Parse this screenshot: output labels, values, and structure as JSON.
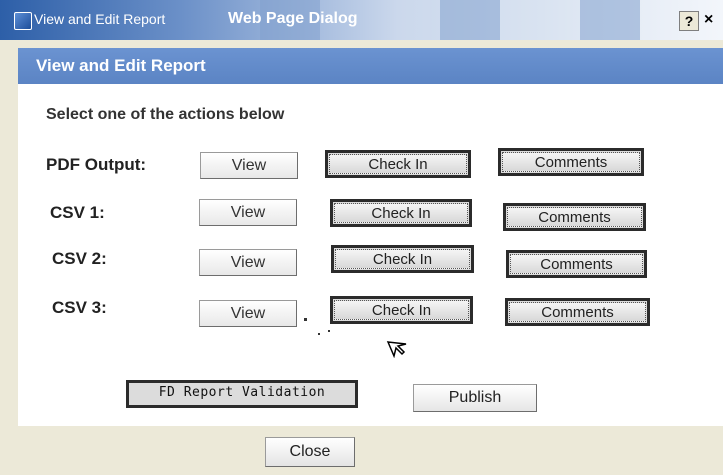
{
  "window": {
    "title": "View and Edit Report",
    "subtitle": "Web Page Dialog",
    "help_label": "?",
    "close_label": "×"
  },
  "header": {
    "title": "View and Edit  Report"
  },
  "instruction": "Select one of the actions below",
  "rows": [
    {
      "label": "PDF Output:",
      "view": "View",
      "checkin": "Check In",
      "comments": "Comments"
    },
    {
      "label": "CSV 1:",
      "view": "View",
      "checkin": "Check In",
      "comments": "Comments"
    },
    {
      "label": "CSV 2:",
      "view": "View",
      "checkin": "Check In",
      "comments": "Comments"
    },
    {
      "label": "CSV 3:",
      "view": "View",
      "checkin": "Check In",
      "comments": "Comments"
    }
  ],
  "actions": {
    "validation": "FD Report Validation",
    "publish": "Publish"
  },
  "footer": {
    "close": "Close"
  }
}
